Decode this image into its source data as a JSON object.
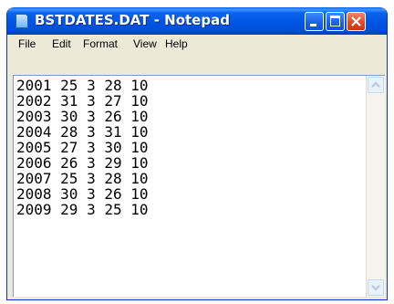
{
  "window": {
    "title": "BSTDATES.DAT - Notepad",
    "colors": {
      "titlebar": "#0054e3",
      "close_button": "#e0492a",
      "frame": "#ece9d8"
    }
  },
  "menu": {
    "file": "File",
    "edit": "Edit",
    "format": "Format",
    "view": "View",
    "help": "Help"
  },
  "document": {
    "text": "2001 25 3 28 10\n2002 31 3 27 10\n2003 30 3 26 10\n2004 28 3 31 10\n2005 27 3 30 10\n2006 26 3 29 10\n2007 25 3 28 10\n2008 30 3 26 10\n2009 29 3 25 10"
  },
  "icons": {
    "app": "notepad-icon",
    "minimize": "minimize-icon",
    "maximize": "maximize-icon",
    "close": "close-icon",
    "scroll_up": "chevron-up-icon",
    "scroll_down": "chevron-down-icon"
  }
}
